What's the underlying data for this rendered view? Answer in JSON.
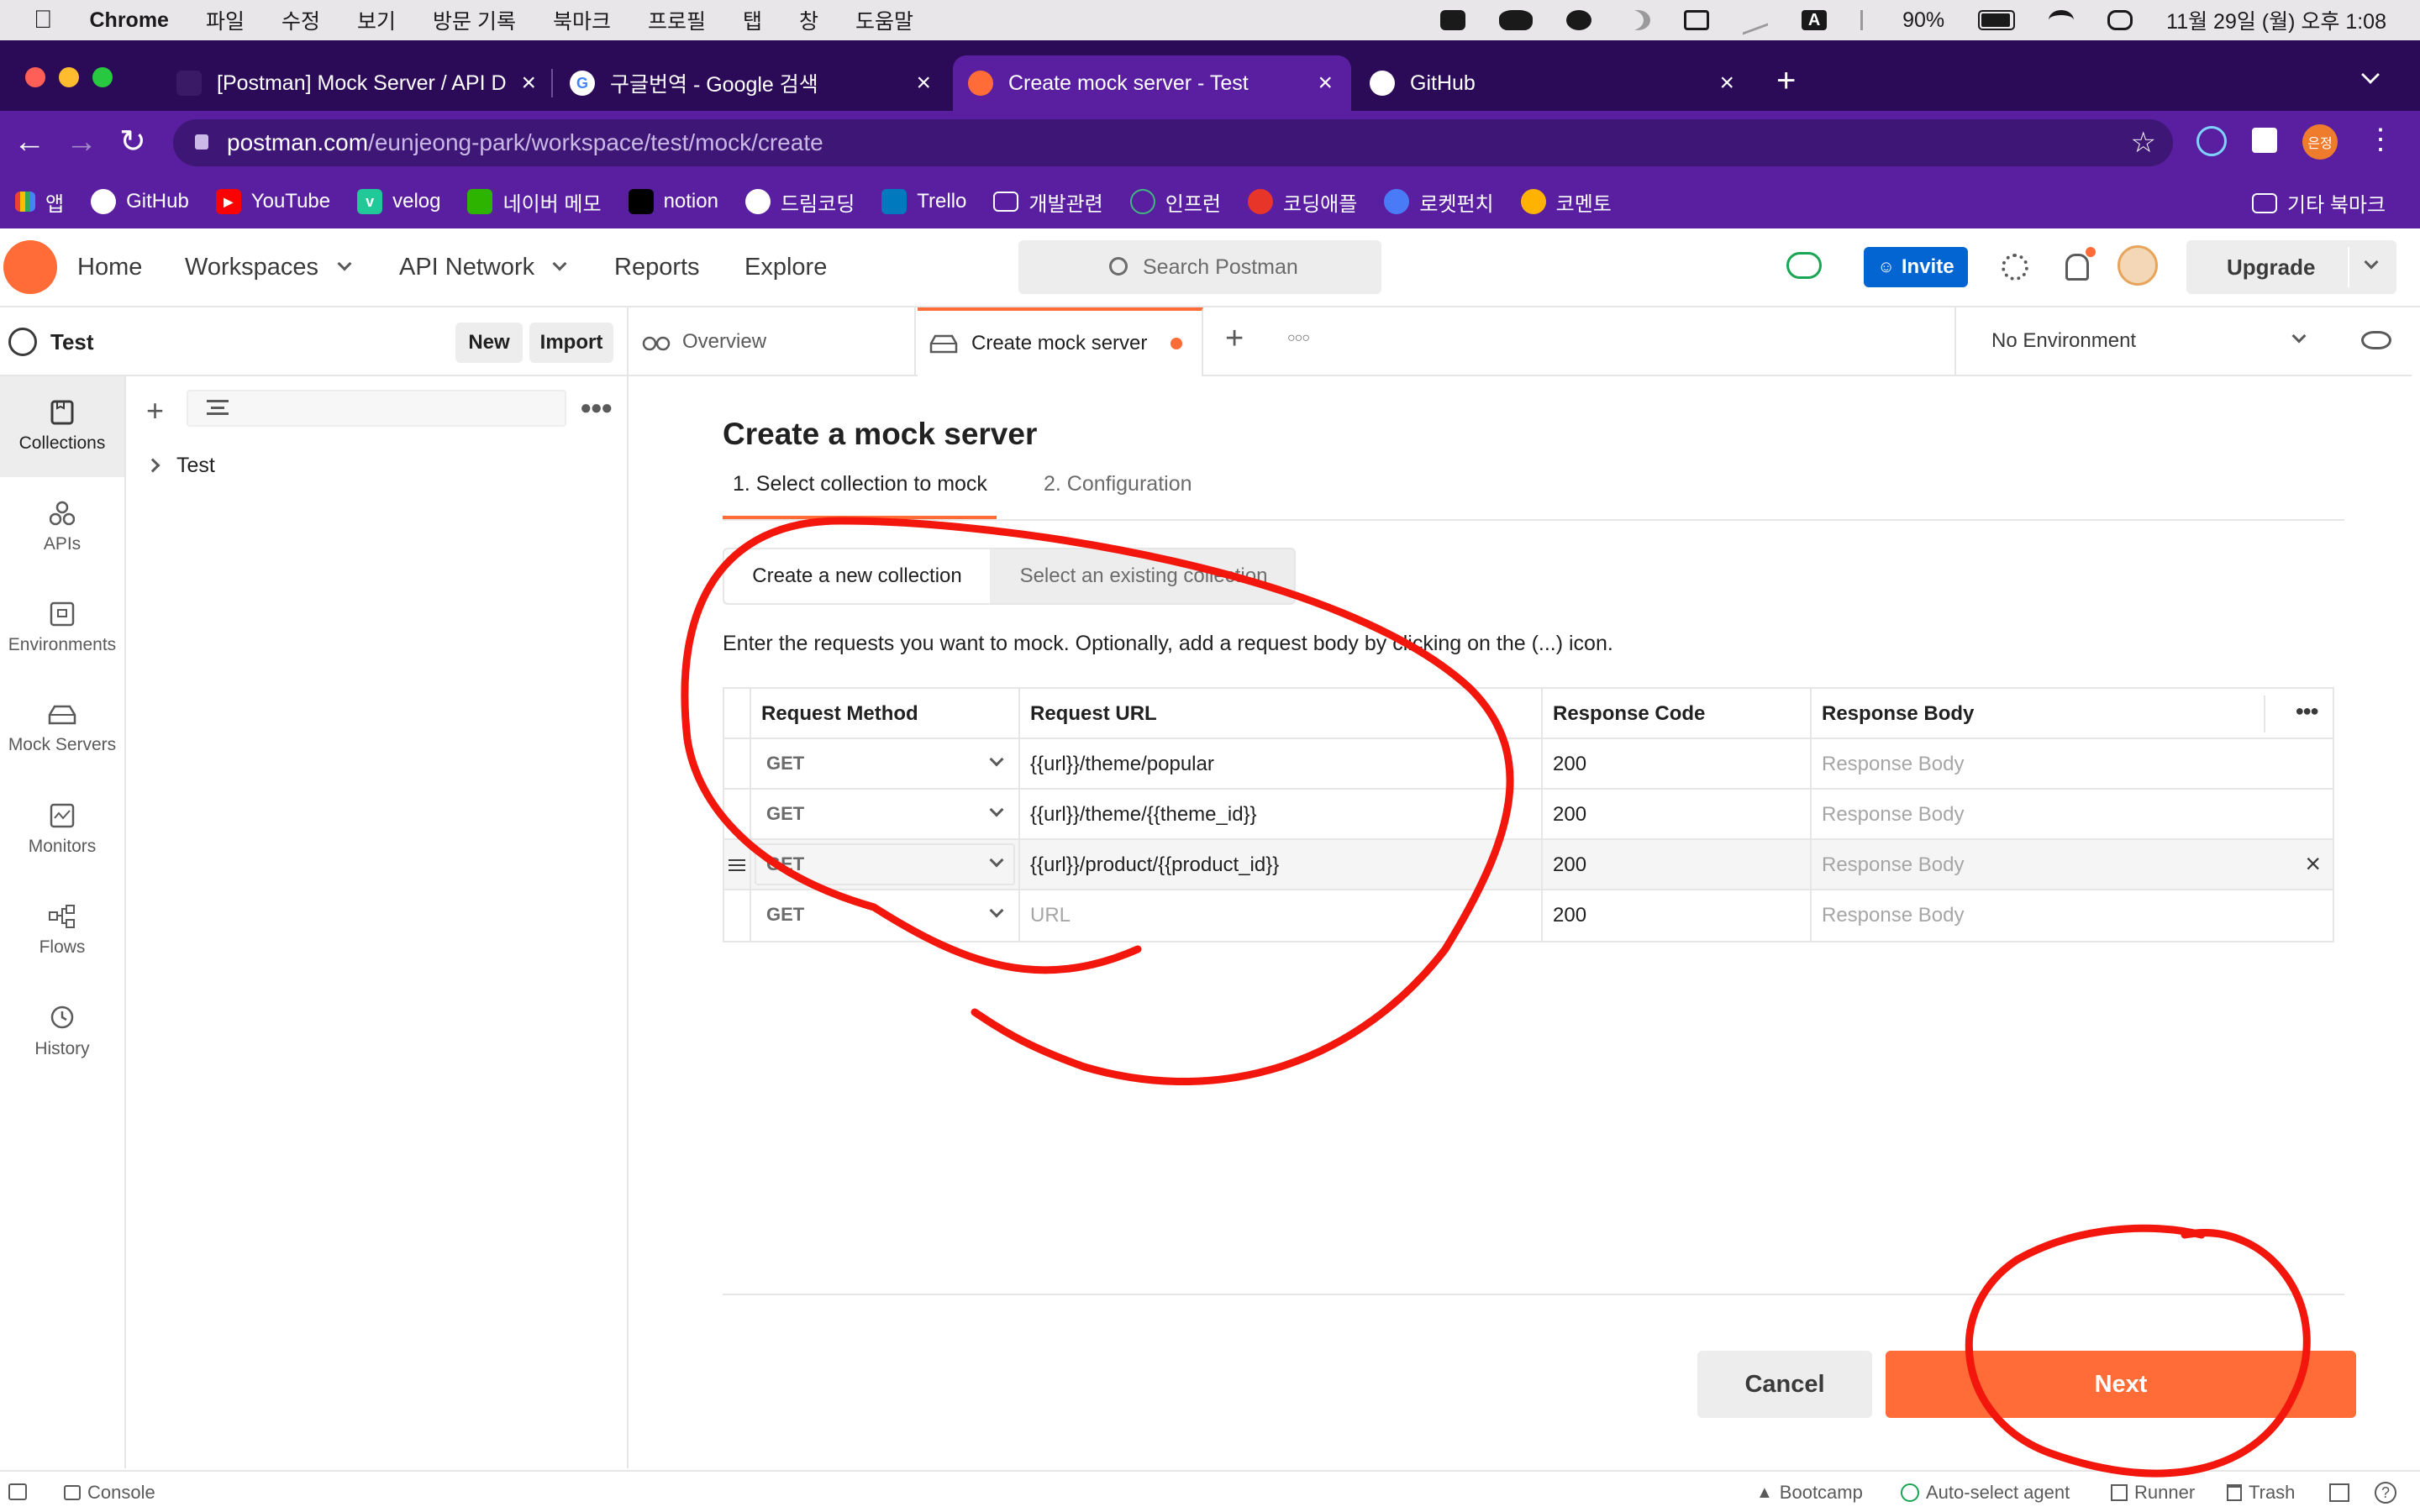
{
  "mac_menu": {
    "items": [
      "Chrome",
      "파일",
      "수정",
      "보기",
      "방문 기록",
      "북마크",
      "프로필",
      "탭",
      "창",
      "도움말"
    ],
    "battery": "90%",
    "clock": "11월 29일 (월) 오후 1:08"
  },
  "browser": {
    "tabs": [
      {
        "title": "[Postman] Mock Server / API D",
        "active": false
      },
      {
        "title": "구글번역 - Google 검색",
        "active": false
      },
      {
        "title": "Create mock server - Test",
        "active": true
      },
      {
        "title": "GitHub",
        "active": false
      }
    ],
    "url_host": "postman.com",
    "url_path": "/eunjeong-park/workspace/test/mock/create",
    "profile_label": "은정",
    "bookmarks": [
      "앱",
      "GitHub",
      "YouTube",
      "velog",
      "네이버 메모",
      "notion",
      "드림코딩",
      "Trello",
      "개발관련",
      "인프런",
      "코딩애플",
      "로켓펀치",
      "코멘토"
    ],
    "other_bookmarks": "기타 북마크"
  },
  "postman_header": {
    "nav": [
      "Home",
      "Workspaces",
      "API Network",
      "Reports",
      "Explore"
    ],
    "search_placeholder": "Search Postman",
    "invite": "Invite",
    "upgrade": "Upgrade"
  },
  "workspace": {
    "name": "Test",
    "new_label": "New",
    "import_label": "Import"
  },
  "rail": [
    "Collections",
    "APIs",
    "Environments",
    "Mock Servers",
    "Monitors",
    "Flows",
    "History"
  ],
  "sidebar": {
    "tree": [
      {
        "label": "Test"
      }
    ]
  },
  "editor_tabs": {
    "overview": "Overview",
    "active": "Create mock server",
    "environment": "No Environment"
  },
  "page": {
    "title": "Create a mock server",
    "step1": "1.  Select collection to mock",
    "step2": "2.  Configuration",
    "seg_new": "Create a new collection",
    "seg_existing": "Select an existing collection",
    "instructions": "Enter the requests you want to mock. Optionally, add a request body by clicking on the (...) icon.",
    "table": {
      "headers": [
        "Request Method",
        "Request URL",
        "Response Code",
        "Response Body"
      ],
      "rows": [
        {
          "method": "GET",
          "url": "{{url}}/theme/popular",
          "code": "200",
          "body": ""
        },
        {
          "method": "GET",
          "url": "{{url}}/theme/{{theme_id}}",
          "code": "200",
          "body": ""
        },
        {
          "method": "GET",
          "url": "{{url}}/product/{{product_id}}",
          "code": "200",
          "body": ""
        },
        {
          "method": "GET",
          "url": "",
          "code": "200",
          "body": ""
        }
      ],
      "url_placeholder": "URL",
      "body_placeholder": "Response Body"
    },
    "cancel": "Cancel",
    "next": "Next"
  },
  "statusbar": {
    "console": "Console",
    "bootcamp": "Bootcamp",
    "auto_select": "Auto-select agent",
    "runner": "Runner",
    "trash": "Trash"
  },
  "colors": {
    "accent": "#ff6c37",
    "invite_blue": "#0265d2",
    "chrome_purple": "#5a1fa0",
    "annotation_red": "#f2160c"
  }
}
